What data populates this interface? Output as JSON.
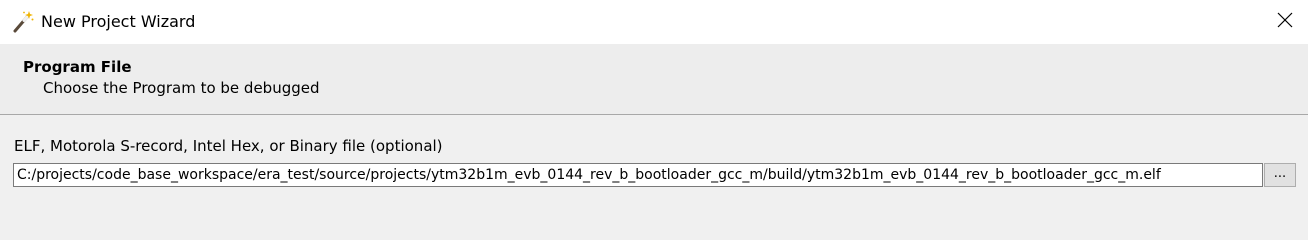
{
  "window": {
    "title": "New Project Wizard",
    "icon": "magic-wand-icon",
    "close_icon": "close-icon"
  },
  "header": {
    "title": "Program File",
    "subtitle": "Choose the Program to be debugged"
  },
  "form": {
    "file_label": "ELF, Motorola S-record, Intel Hex, or Binary file (optional)",
    "file_path": "C:/projects/code_base_workspace/era_test/source/projects/ytm32b1m_evb_0144_rev_b_bootloader_gcc_m/build/ytm32b1m_evb_0144_rev_b_bootloader_gcc_m.elf",
    "browse_label": "..."
  }
}
